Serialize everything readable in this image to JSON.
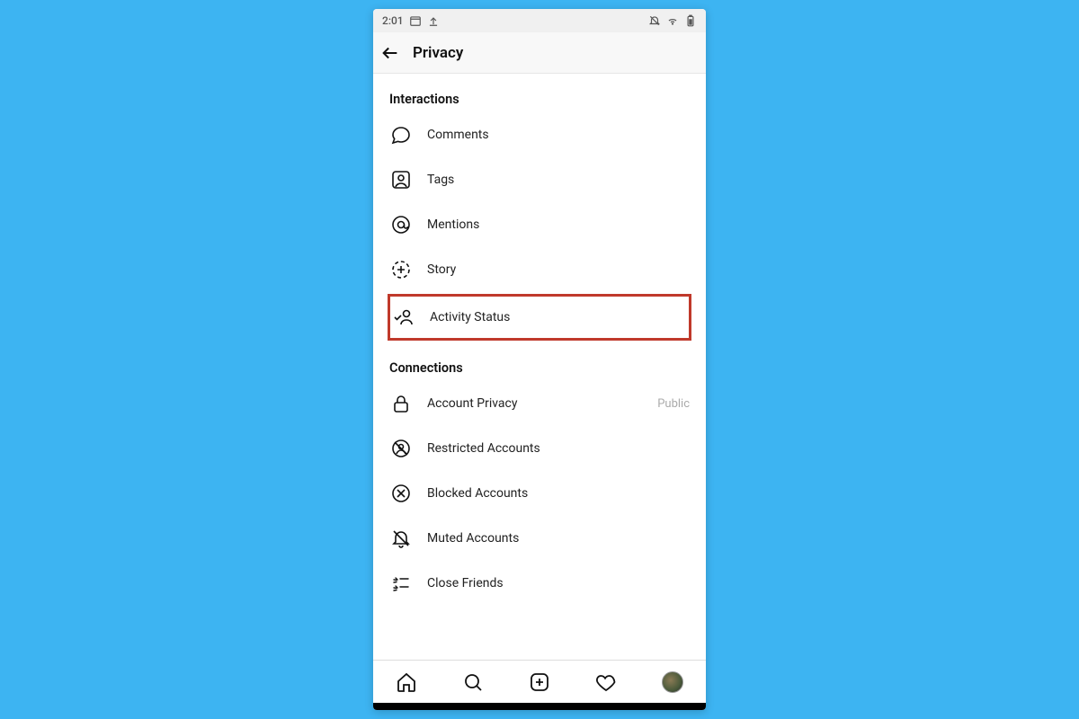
{
  "statusbar": {
    "time": "2:01"
  },
  "appbar": {
    "title": "Privacy"
  },
  "sections": {
    "interactions": {
      "header": "Interactions",
      "items": {
        "comments": "Comments",
        "tags": "Tags",
        "mentions": "Mentions",
        "story": "Story",
        "activity_status": "Activity Status"
      }
    },
    "connections": {
      "header": "Connections",
      "items": {
        "account_privacy": {
          "label": "Account Privacy",
          "value": "Public"
        },
        "restricted": "Restricted Accounts",
        "blocked": "Blocked Accounts",
        "muted": "Muted Accounts",
        "close_friends": "Close Friends"
      }
    }
  }
}
